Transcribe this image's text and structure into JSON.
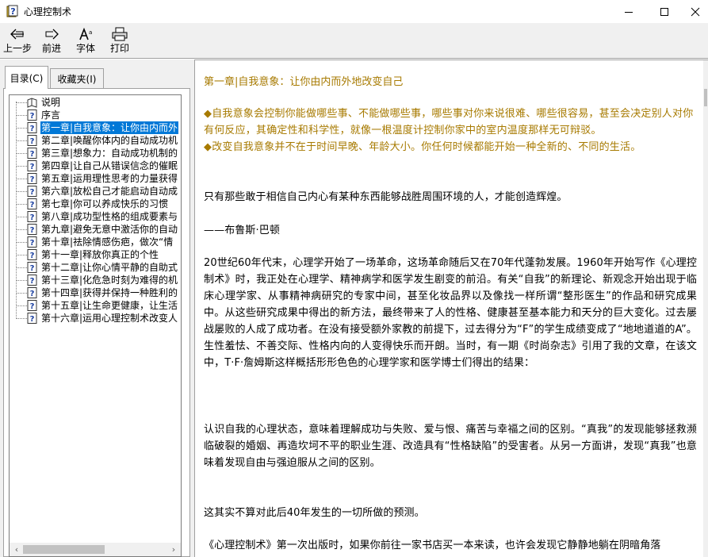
{
  "window": {
    "title": "心理控制术",
    "app_icon": "help-book-icon",
    "controls": [
      "minimize-icon",
      "maximize-icon",
      "close-icon"
    ]
  },
  "toolbar": {
    "back_label": "上一步",
    "forward_label": "前进",
    "font_label": "字体",
    "print_label": "打印"
  },
  "tabs": {
    "contents_label": "目录(C)",
    "favorites_label": "收藏夹(I)"
  },
  "tree": {
    "items": [
      {
        "label": "说明",
        "icon": "book-icon"
      },
      {
        "label": "序言",
        "icon": "help-page-icon"
      },
      {
        "label": "第一章|自我意象：让你由内而外",
        "icon": "help-page-icon",
        "selected": true
      },
      {
        "label": "第二章|唤醒你体内的自动成功机",
        "icon": "help-page-icon"
      },
      {
        "label": "第三章|想象力：自动成功机制的",
        "icon": "help-page-icon"
      },
      {
        "label": "第四章|让自己从错误信念的催眠",
        "icon": "help-page-icon"
      },
      {
        "label": "第五章|运用理性思考的力量获得",
        "icon": "help-page-icon"
      },
      {
        "label": "第六章|放松自己才能启动自动成",
        "icon": "help-page-icon"
      },
      {
        "label": "第七章|你可以养成快乐的习惯",
        "icon": "help-page-icon"
      },
      {
        "label": "第八章|成功型性格的组成要素与",
        "icon": "help-page-icon"
      },
      {
        "label": "第九章|避免无意中激活你的自动",
        "icon": "help-page-icon"
      },
      {
        "label": "第十章|祛除情感伤疤，做次“情",
        "icon": "help-page-icon"
      },
      {
        "label": "第十一章|释放你真正的个性",
        "icon": "help-page-icon"
      },
      {
        "label": "第十二章|让你心情平静的自助式",
        "icon": "help-page-icon"
      },
      {
        "label": "第十三章|化危急时刻为难得的机",
        "icon": "help-page-icon"
      },
      {
        "label": "第十四章|获得并保持一种胜利的",
        "icon": "help-page-icon"
      },
      {
        "label": "第十五章|让生命更健康，让生活",
        "icon": "help-page-icon"
      },
      {
        "label": "第十六章|运用心理控制术改变人",
        "icon": "help-page-icon"
      }
    ]
  },
  "content": {
    "chapter_title": "第一章|自我意象：让你由内而外地改变自己",
    "key_points": [
      "◆自我意象会控制你能做哪些事、不能做哪些事，哪些事对你来说很难、哪些很容易，甚至会决定别人对你有何反应，其确定性和科学性，就像一根温度计控制你家中的室内温度那样无可辩驳。",
      "◆改变自我意象并不在于时间早晚、年龄大小。你任何时候都能开始一种全新的、不同的生活。"
    ],
    "paragraphs": [
      "只有那些敢于相信自己内心有某种东西能够战胜周围环境的人，才能创造辉煌。",
      "——布鲁斯·巴顿",
      "20世纪60年代末，心理学开始了一场革命，这场革命随后又在70年代蓬勃发展。1960年开始写作《心理控制术》时，我正处在心理学、精神病学和医学发生剧变的前沿。有关“自我”的新理论、新观念开始出现于临床心理学家、从事精神病研究的专家中间，甚至化妆品界以及像找一样所谓“整形医生”的作品和研究成果中。从这些研究成果中得出的新方法，最终带来了人的性格、健康甚至基本能力和天分的巨大变化。过去屡战屡败的人成了成功者。在没有接受额外家教的前提下，过去得分为“F”的学生成绩变成了“地地道道的A”。生性羞怯、不善交际、性格内向的人变得快乐而开朗。当时，有一期《时尚杂志》引用了我的文章，在该文中，T·F·詹姆斯这样概括形形色色的心理学家和医学博士们得出的结果：",
      "认识自我的心理状态，意味着理解成功与失败、爱与恨、痛苦与幸福之间的区别。“真我”的发现能够拯救濒临破裂的婚姻、再造坎坷不平的职业生涯、改造具有“性格缺陷”的受害者。从另一方面讲，发现“真我”也意味着发现自由与强迫服从之间的区别。",
      "这其实不算对此后40年发生的一切所做的预测。",
      "《心理控制术》第一次出版时，如果你前往一家书店买一本来读，也许会发现它静静地躺在阴暗角落"
    ]
  },
  "colors": {
    "highlight_text": "#a77a00",
    "selection": "#0078d7"
  }
}
